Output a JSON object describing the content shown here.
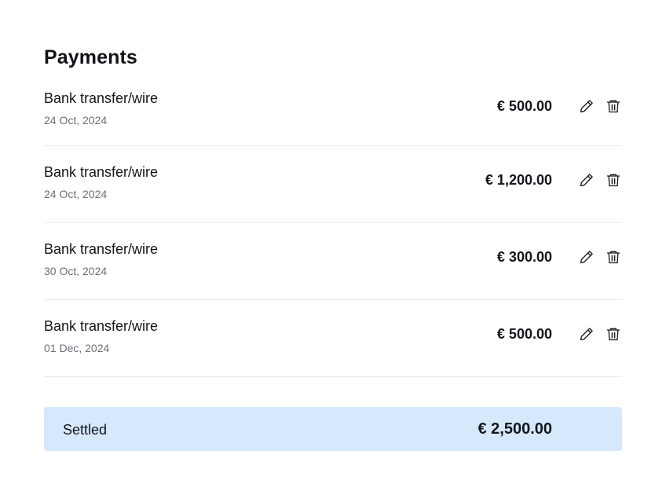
{
  "header": {
    "title": "Payments"
  },
  "payments": [
    {
      "method": "Bank transfer/wire",
      "date": "24 Oct, 2024",
      "amount": "€ 500.00"
    },
    {
      "method": "Bank transfer/wire",
      "date": "24 Oct, 2024",
      "amount": "€ 1,200.00"
    },
    {
      "method": "Bank transfer/wire",
      "date": "30 Oct, 2024",
      "amount": "€ 300.00"
    },
    {
      "method": "Bank transfer/wire",
      "date": "01 Dec, 2024",
      "amount": "€ 500.00"
    }
  ],
  "icons": {
    "edit": "pencil-icon",
    "delete": "trash-icon"
  },
  "summary": {
    "label": "Settled",
    "total": "€ 2,500.00"
  },
  "colors": {
    "summary_bg": "#d6e8fc",
    "divider": "#e9eaee",
    "muted_text": "#6b6f76"
  }
}
